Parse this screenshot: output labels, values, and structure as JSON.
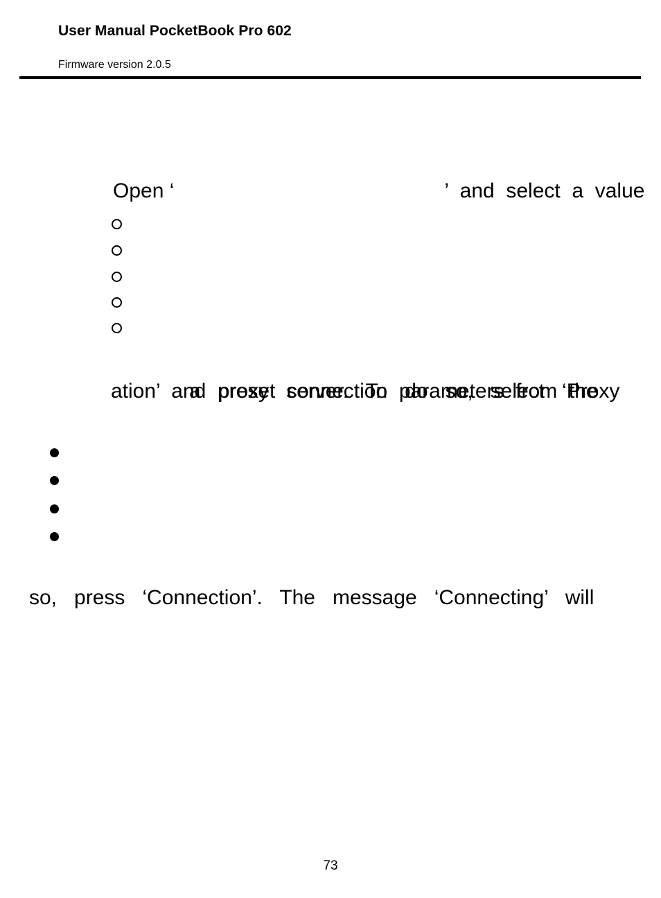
{
  "document": {
    "title": "User Manual PocketBook Pro 602",
    "subtitle": "Firmware version 2.0.5",
    "page_number": "73"
  },
  "body": {
    "open_line": {
      "run1": "Open ‘",
      "run2": "",
      "run3": "’  and  select  a  value"
    },
    "hollow_bullets": [
      {
        "glyph": "○",
        "text": ""
      },
      {
        "glyph": "○",
        "text": ""
      },
      {
        "glyph": "○",
        "text": ""
      },
      {
        "glyph": "○",
        "text": ""
      },
      {
        "glyph": "○",
        "text": ""
      }
    ],
    "proxy_paragraph": {
      "line1_lead": "",
      "line1": "a   proxy   server.   To   do   so,   select   ‘Proxy",
      "line2": "ation’  and  preset  connection  parameters  from  the"
    },
    "filled_bullets": [
      {
        "glyph": "●",
        "text": ""
      },
      {
        "glyph": "●",
        "text": ""
      },
      {
        "glyph": "●",
        "text": ""
      },
      {
        "glyph": "●",
        "text": ""
      }
    ],
    "connection_line": "so,   press   ‘Connection’.   The   message   ‘Connecting’   will"
  },
  "colors": {
    "text": "#000000",
    "background": "#ffffff",
    "rule": "#000000"
  }
}
